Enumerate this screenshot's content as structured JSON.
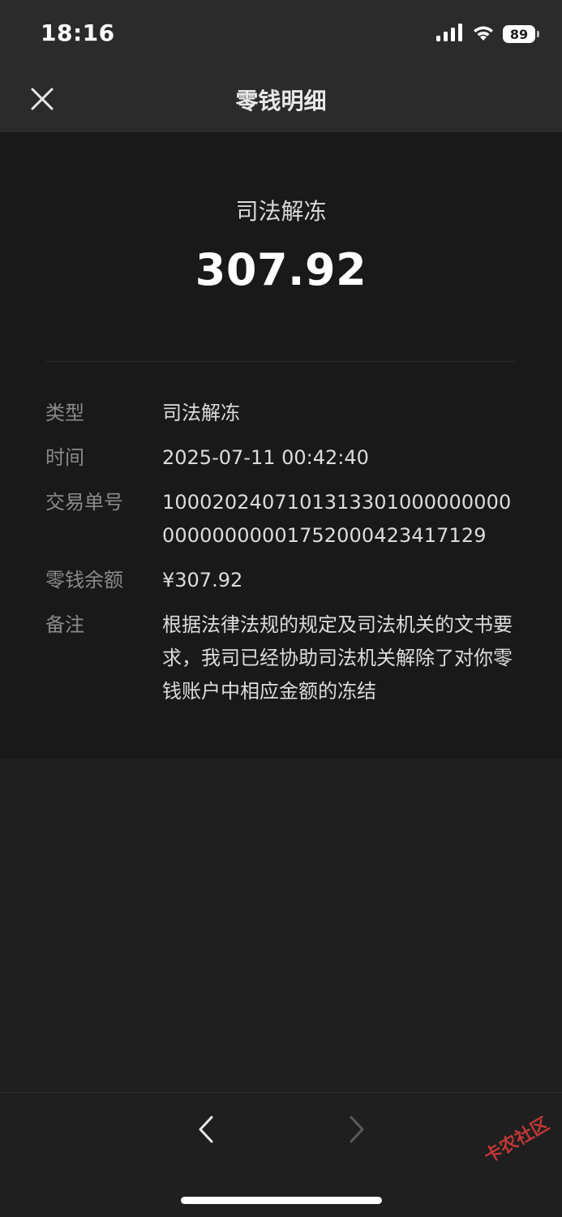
{
  "status_bar": {
    "time": "18:16",
    "battery": "89",
    "icons": [
      "signal-icon",
      "wifi-icon",
      "battery-icon"
    ]
  },
  "nav": {
    "title": "零钱明细",
    "close_icon": "close-icon"
  },
  "summary": {
    "type": "司法解冻",
    "amount": "307.92"
  },
  "details": [
    {
      "label": "类型",
      "value": "司法解冻"
    },
    {
      "label": "时间",
      "value": "2025-07-11 00:42:40"
    },
    {
      "label": "交易单号",
      "value": "100020240710131330100000000000000000001752000423417129"
    },
    {
      "label": "零钱余额",
      "value": "¥307.92"
    },
    {
      "label": "备注",
      "value": "根据法律法规的规定及司法机关的文书要求，我司已经协助司法机关解除了对你零钱账户中相应金额的冻结"
    }
  ],
  "bottom_nav": {
    "back_icon": "chevron-left-icon",
    "forward_icon": "chevron-right-icon"
  },
  "watermark": {
    "text": "卡农社区"
  },
  "colors": {
    "background": "#1f1f1f",
    "card": "#191919",
    "header": "#2b2b2b",
    "label": "#8a8a8a",
    "value": "#dcdcdc",
    "watermark": "#d23a3a"
  }
}
